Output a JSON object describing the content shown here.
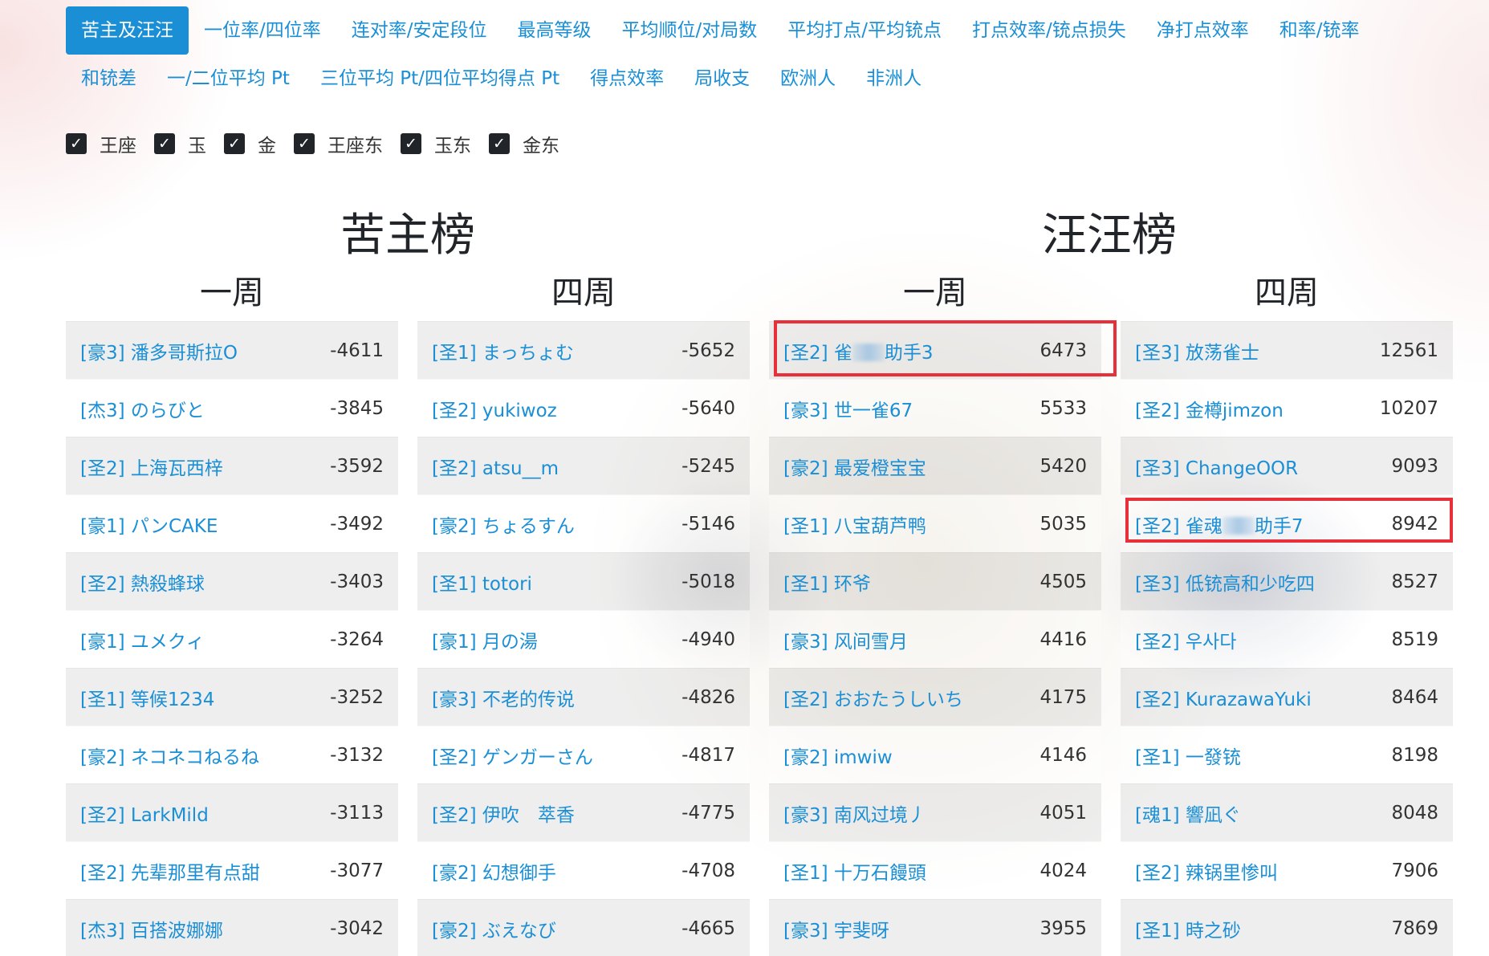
{
  "nav": [
    {
      "label": "苦主及汪汪",
      "active": true
    },
    {
      "label": "一位率/四位率"
    },
    {
      "label": "连对率/安定段位"
    },
    {
      "label": "最高等级"
    },
    {
      "label": "平均顺位/对局数"
    },
    {
      "label": "平均打点/平均铳点"
    },
    {
      "label": "打点效率/铳点损失"
    },
    {
      "label": "净打点效率"
    },
    {
      "label": "和率/铳率"
    },
    {
      "label": "和铳差"
    },
    {
      "label": "一/二位平均 Pt"
    },
    {
      "label": "三位平均 Pt/四位平均得点 Pt"
    },
    {
      "label": "得点效率"
    },
    {
      "label": "局收支"
    },
    {
      "label": "欧洲人"
    },
    {
      "label": "非洲人"
    }
  ],
  "filters": [
    {
      "label": "王座",
      "checked": true
    },
    {
      "label": "玉",
      "checked": true
    },
    {
      "label": "金",
      "checked": true
    },
    {
      "label": "王座东",
      "checked": true
    },
    {
      "label": "玉东",
      "checked": true
    },
    {
      "label": "金东",
      "checked": true
    }
  ],
  "boards": {
    "kuzhu": {
      "title": "苦主榜",
      "week1": {
        "title": "一周",
        "rows": [
          {
            "name": "[豪3] 潘多哥斯拉O",
            "score": "-4611"
          },
          {
            "name": "[杰3] のらびと",
            "score": "-3845"
          },
          {
            "name": "[圣2] 上海瓦西梓",
            "score": "-3592"
          },
          {
            "name": "[豪1] パンCAKE",
            "score": "-3492"
          },
          {
            "name": "[圣2] 熱殺蜂球",
            "score": "-3403"
          },
          {
            "name": "[豪1] ユメクィ",
            "score": "-3264"
          },
          {
            "name": "[圣1] 等候1234",
            "score": "-3252"
          },
          {
            "name": "[豪2] ネコネコねるね",
            "score": "-3132"
          },
          {
            "name": "[圣2] LarkMild",
            "score": "-3113"
          },
          {
            "name": "[圣2] 先辈那里有点甜",
            "score": "-3077"
          },
          {
            "name": "[杰3] 百搭波娜娜",
            "score": "-3042"
          }
        ]
      },
      "week4": {
        "title": "四周",
        "rows": [
          {
            "name": "[圣1] まっちょむ",
            "score": "-5652"
          },
          {
            "name": "[圣2] yukiwoz",
            "score": "-5640"
          },
          {
            "name": "[圣2] atsu__m",
            "score": "-5245"
          },
          {
            "name": "[豪2] ちょるすん",
            "score": "-5146"
          },
          {
            "name": "[圣1] totori",
            "score": "-5018"
          },
          {
            "name": "[豪1] 月の湯",
            "score": "-4940"
          },
          {
            "name": "[豪3] 不老的传说",
            "score": "-4826"
          },
          {
            "name": "[圣2] ゲンガーさん",
            "score": "-4817"
          },
          {
            "name": "[圣2] 伊吹　萃香",
            "score": "-4775"
          },
          {
            "name": "[豪2] 幻想御手",
            "score": "-4708"
          },
          {
            "name": "[豪2] ぶえなび",
            "score": "-4665"
          }
        ]
      }
    },
    "wangwang": {
      "title": "汪汪榜",
      "week1": {
        "title": "一周",
        "rows": [
          {
            "name_pre": "[圣2] 雀",
            "name_post": "助手3",
            "score": "6473",
            "blurred": true
          },
          {
            "name": "[豪3] 世一雀67",
            "score": "5533"
          },
          {
            "name": "[豪2] 最爱橙宝宝",
            "score": "5420"
          },
          {
            "name": "[圣1] 八宝葫芦鸭",
            "score": "5035"
          },
          {
            "name": "[圣1] 环爷",
            "score": "4505"
          },
          {
            "name": "[豪3] 风间雪月",
            "score": "4416"
          },
          {
            "name": "[圣2] おおたうしいち",
            "score": "4175"
          },
          {
            "name": "[豪2] imwiw",
            "score": "4146"
          },
          {
            "name": "[豪3] 南风过境丿",
            "score": "4051"
          },
          {
            "name": "[圣1] 十万石饅頭",
            "score": "4024"
          },
          {
            "name": "[豪3] 宇斐呀",
            "score": "3955"
          }
        ]
      },
      "week4": {
        "title": "四周",
        "rows": [
          {
            "name": "[圣3] 放荡雀士",
            "score": "12561"
          },
          {
            "name": "[圣2] 金樽jimzon",
            "score": "10207"
          },
          {
            "name": "[圣3] ChangeOOR",
            "score": "9093"
          },
          {
            "name_pre": "[圣2] 雀魂",
            "name_post": "助手7",
            "score": "8942",
            "blurred": true
          },
          {
            "name": "[圣3] 低铳高和少吃四",
            "score": "8527"
          },
          {
            "name": "[圣2] 우사다",
            "score": "8519"
          },
          {
            "name": "[圣2] KurazawaYuki",
            "score": "8464"
          },
          {
            "name": "[圣1] 一發铳",
            "score": "8198"
          },
          {
            "name": "[魂1] 響凪ぐ",
            "score": "8048"
          },
          {
            "name": "[圣2] 辣锅里惨叫",
            "score": "7906"
          },
          {
            "name": "[圣1] 時之砂",
            "score": "7869"
          }
        ]
      }
    }
  },
  "highlight_color": "#e8303a",
  "accent_color": "#1a8fd6"
}
